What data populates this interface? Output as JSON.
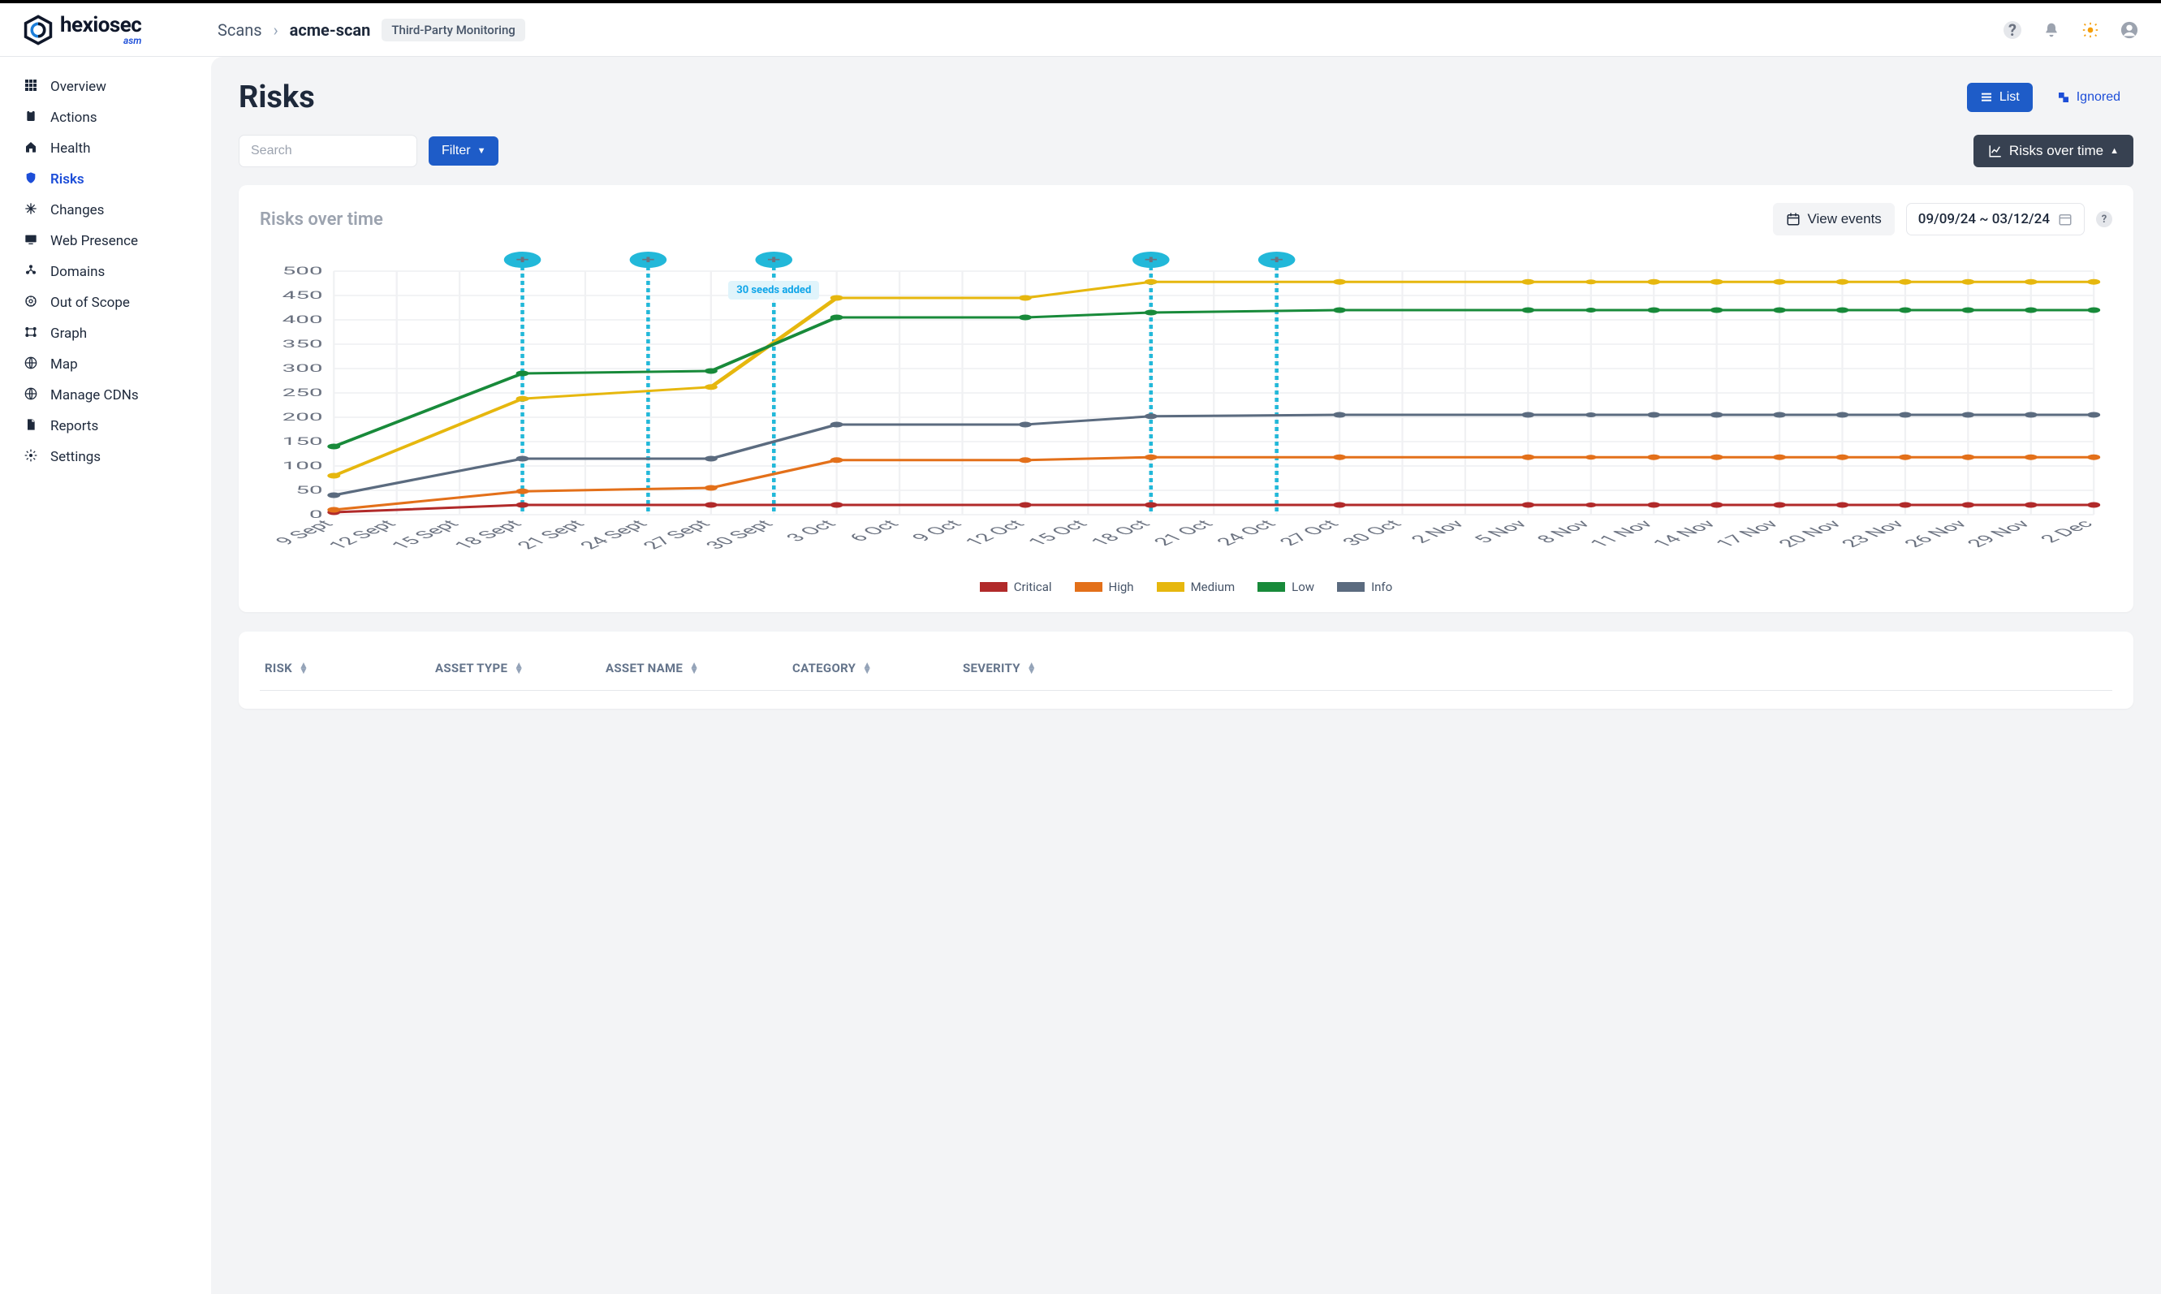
{
  "brand": {
    "name": "hexiosec",
    "sub": "asm"
  },
  "breadcrumb": {
    "root": "Scans",
    "current": "acme-scan",
    "badge": "Third-Party Monitoring"
  },
  "sidebar": {
    "items": [
      {
        "label": "Overview"
      },
      {
        "label": "Actions"
      },
      {
        "label": "Health"
      },
      {
        "label": "Risks"
      },
      {
        "label": "Changes"
      },
      {
        "label": "Web Presence"
      },
      {
        "label": "Domains"
      },
      {
        "label": "Out of Scope"
      },
      {
        "label": "Graph"
      },
      {
        "label": "Map"
      },
      {
        "label": "Manage CDNs"
      },
      {
        "label": "Reports"
      },
      {
        "label": "Settings"
      }
    ],
    "active_index": 3
  },
  "page": {
    "title": "Risks"
  },
  "actions": {
    "list": "List",
    "ignored": "Ignored"
  },
  "toolbar": {
    "search_placeholder": "Search",
    "filter": "Filter",
    "risks_over_time": "Risks over time"
  },
  "chart_card": {
    "title": "Risks over time",
    "view_events": "View events",
    "date_range": "09/09/24 ~ 03/12/24",
    "annotation_label": "30 seeds added"
  },
  "legend": {
    "critical": "Critical",
    "high": "High",
    "medium": "Medium",
    "low": "Low",
    "info": "Info"
  },
  "colors": {
    "critical": "#b12a2a",
    "high": "#e3701a",
    "medium": "#e6b70e",
    "low": "#188a3a",
    "info": "#5b6b7f",
    "annotation": "#22b8d9"
  },
  "table": {
    "cols": {
      "risk": "RISK",
      "asset_type": "ASSET TYPE",
      "asset_name": "ASSET NAME",
      "category": "CATEGORY",
      "severity": "SEVERITY"
    }
  },
  "chart_data": {
    "type": "line",
    "xlabel": "",
    "ylabel": "",
    "ylim": [
      0,
      500
    ],
    "yticks": [
      0,
      50,
      100,
      150,
      200,
      250,
      300,
      350,
      400,
      450,
      500
    ],
    "categories": [
      "9 Sept",
      "12 Sept",
      "15 Sept",
      "18 Sept",
      "21 Sept",
      "24 Sept",
      "27 Sept",
      "30 Sept",
      "3 Oct",
      "6 Oct",
      "9 Oct",
      "12 Oct",
      "15 Oct",
      "18 Oct",
      "21 Oct",
      "24 Oct",
      "27 Oct",
      "30 Oct",
      "2 Nov",
      "5 Nov",
      "8 Nov",
      "11 Nov",
      "14 Nov",
      "17 Nov",
      "20 Nov",
      "23 Nov",
      "26 Nov",
      "29 Nov",
      "2 Dec"
    ],
    "sample_x_indices": [
      0,
      3,
      6,
      8,
      11,
      13,
      16,
      19,
      21,
      22,
      23,
      24,
      25,
      26,
      27,
      28
    ],
    "series": [
      {
        "name": "Critical",
        "color": "#b12a2a",
        "values": [
          5,
          20,
          20,
          20,
          20,
          20,
          20,
          20,
          20,
          20,
          20,
          20,
          20,
          20,
          20,
          20
        ]
      },
      {
        "name": "High",
        "color": "#e3701a",
        "values": [
          10,
          48,
          55,
          112,
          112,
          118,
          118,
          118,
          118,
          118,
          118,
          118,
          118,
          118,
          118,
          118
        ]
      },
      {
        "name": "Medium",
        "color": "#e6b70e",
        "values": [
          80,
          238,
          262,
          445,
          445,
          478,
          478,
          478,
          478,
          478,
          478,
          478,
          478,
          478,
          478,
          478
        ]
      },
      {
        "name": "Low",
        "color": "#188a3a",
        "values": [
          140,
          290,
          295,
          405,
          405,
          415,
          420,
          420,
          420,
          420,
          420,
          420,
          420,
          420,
          420,
          420
        ]
      },
      {
        "name": "Info",
        "color": "#5b6b7f",
        "values": [
          40,
          115,
          115,
          185,
          185,
          202,
          205,
          205,
          205,
          205,
          205,
          205,
          205,
          205,
          205,
          205
        ]
      }
    ],
    "event_markers_x": [
      3,
      5,
      7,
      13,
      15
    ],
    "annotation": {
      "x": 7,
      "text": "30 seeds added"
    }
  }
}
